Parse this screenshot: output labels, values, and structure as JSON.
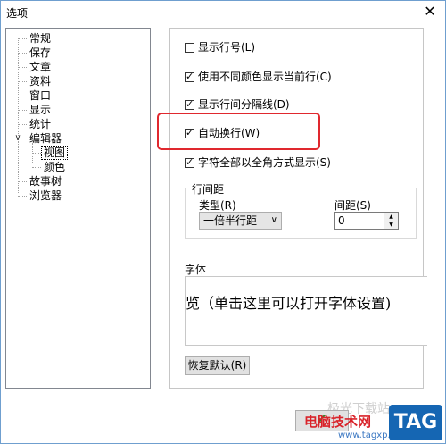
{
  "window": {
    "title": "选项",
    "close": "✕"
  },
  "tree": {
    "items": [
      {
        "label": "常规"
      },
      {
        "label": "保存"
      },
      {
        "label": "文章"
      },
      {
        "label": "资料"
      },
      {
        "label": "窗口"
      },
      {
        "label": "显示"
      },
      {
        "label": "统计"
      },
      {
        "label": "编辑器",
        "expander": "∨"
      },
      {
        "label": "视图"
      },
      {
        "label": "颜色"
      },
      {
        "label": "故事树"
      },
      {
        "label": "浏览器"
      }
    ]
  },
  "options": [
    {
      "label": "显示行号(L)",
      "checked": false
    },
    {
      "label": "使用不同颜色显示当前行(C)",
      "checked": true
    },
    {
      "label": "显示行间分隔线(D)",
      "checked": true
    },
    {
      "label": "自动换行(W)",
      "checked": true
    },
    {
      "label": "字符全部以全角方式显示(S)",
      "checked": true
    }
  ],
  "spacing": {
    "group_title": "行间距",
    "type_label": "类型(R)",
    "type_value": "一倍半行距",
    "gap_label": "间距(S)",
    "gap_value": "0"
  },
  "font": {
    "label": "字体",
    "preview": "览（单击这里可以打开字体设置)"
  },
  "buttons": {
    "reset": "恢复默认(R)",
    "ok_icon": "✔"
  },
  "watermark": {
    "brand": "电脑技术网",
    "url": "www.tagxp.com",
    "logo": "TAG",
    "ghost": "极光下载站"
  },
  "colors": {
    "highlight": "#e0282e",
    "watermark_red": "#d9232a",
    "logo_blue": "#1566b3"
  }
}
